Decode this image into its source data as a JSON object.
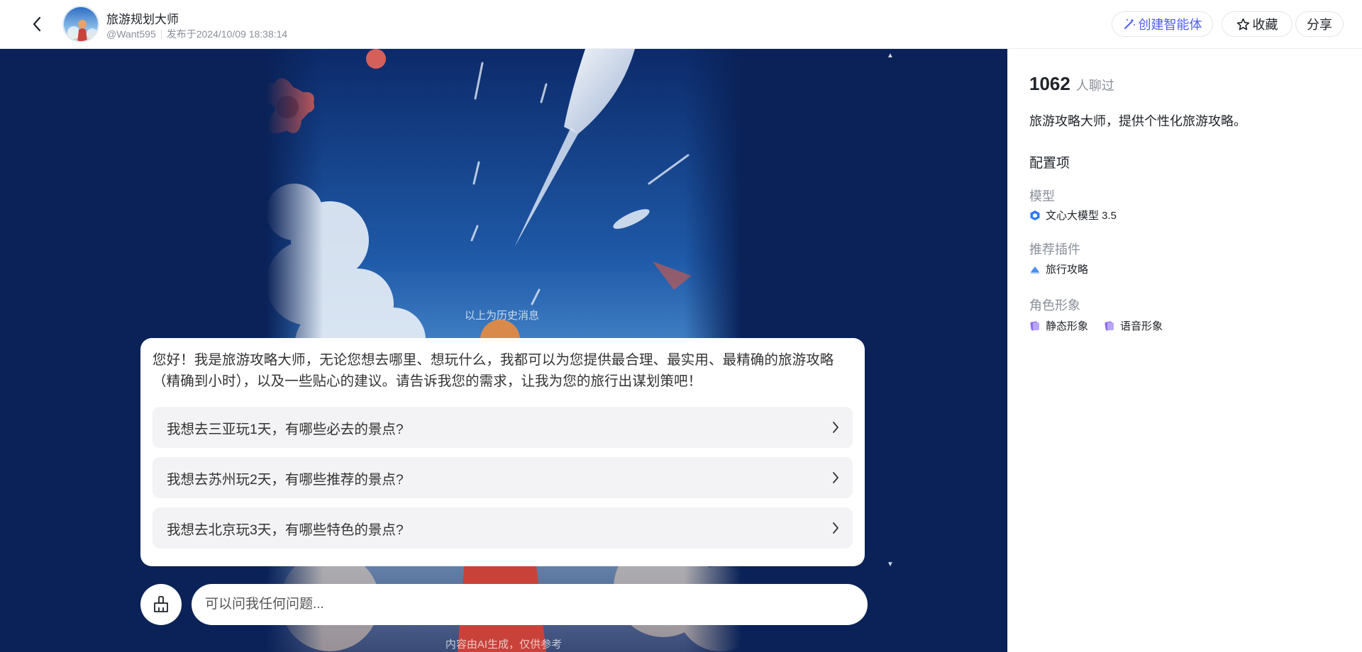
{
  "header": {
    "title": "旅游规划大师",
    "author": "@Want595",
    "published": "发布于2024/10/09 18:38:14",
    "create_label": "创建智能体",
    "favorite_label": "收藏",
    "share_label": "分享"
  },
  "chat": {
    "history_label": "以上为历史消息",
    "greeting": "您好！我是旅游攻略大师，无论您想去哪里、想玩什么，我都可以为您提供最合理、最实用、最精确的旅游攻略（精确到小时），以及一些贴心的建议。请告诉我您的需求，让我为您的旅行出谋划策吧！",
    "suggestions": [
      "我想去三亚玩1天，有哪些必去的景点?",
      "我想去苏州玩2天，有哪些推荐的景点?",
      "我想去北京玩3天，有哪些特色的景点?"
    ],
    "input_placeholder": "可以问我任何问题...",
    "disclaimer": "内容由AI生成，仅供参考"
  },
  "sidebar": {
    "chat_count": "1062",
    "chat_count_unit": "人聊过",
    "description": "旅游攻略大师，提供个性化旅游攻略。",
    "config_title": "配置项",
    "model_label": "模型",
    "model_value": "文心大模型 3.5",
    "plugin_label": "推荐插件",
    "plugin_value": "旅行攻略",
    "persona_label": "角色形象",
    "persona_items": [
      "静态形象",
      "语音形象"
    ]
  },
  "colors": {
    "accent": "#4e5ef5",
    "stage_bg": "#0a2258",
    "card_bg": "#ffffff",
    "suggestion_bg": "#f3f3f5"
  },
  "icons": [
    "back-arrow-icon",
    "magic-wand-icon",
    "star-icon",
    "chevron-right-icon",
    "broom-icon",
    "model-cube-icon",
    "plugin-icon",
    "persona-card-icon"
  ]
}
